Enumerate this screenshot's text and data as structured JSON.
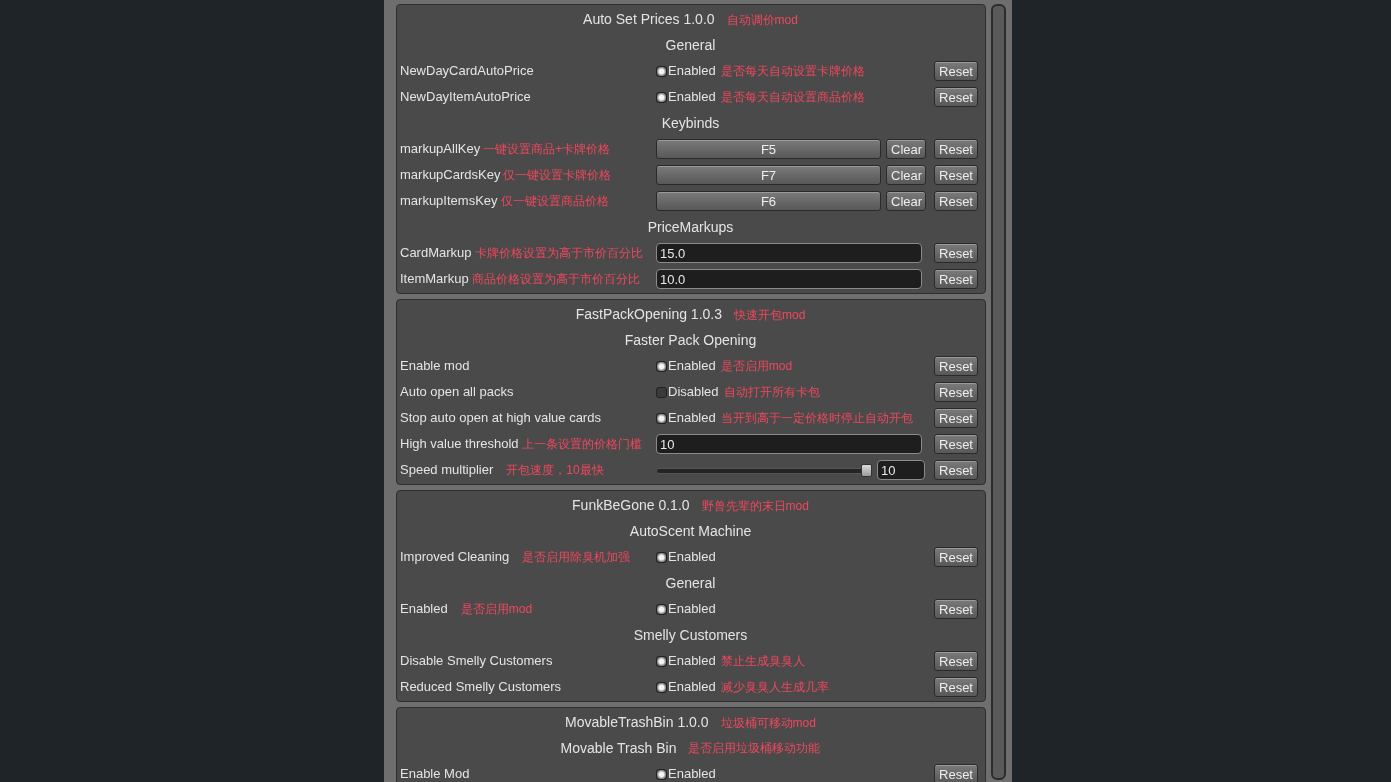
{
  "sections": [
    {
      "title": "Auto Set Prices 1.0.0",
      "note": "自动调价mod",
      "groups": [
        {
          "heading": "General",
          "rows": [
            {
              "kind": "toggle",
              "label": "NewDayCardAutoPrice",
              "checked": true,
              "state_text": "Enabled",
              "control_note": "是否每天自动设置卡牌价格",
              "reset": "Reset"
            },
            {
              "kind": "toggle",
              "label": "NewDayItemAutoPrice",
              "checked": true,
              "state_text": "Enabled",
              "control_note": "是否每天自动设置商品价格",
              "reset": "Reset"
            }
          ]
        },
        {
          "heading": "Keybinds",
          "rows": [
            {
              "kind": "key",
              "label": "markupAllKey",
              "value": "F5",
              "clear": "Clear",
              "label_note": "一键设置商品+卡牌价格",
              "reset": "Reset"
            },
            {
              "kind": "key",
              "label": "markupCardsKey",
              "value": "F7",
              "clear": "Clear",
              "label_note": "仅一键设置卡牌价格",
              "reset": "Reset"
            },
            {
              "kind": "key",
              "label": "markupItemsKey",
              "value": "F6",
              "clear": "Clear",
              "label_note": "仅一键设置商品价格",
              "reset": "Reset"
            }
          ]
        },
        {
          "heading": "PriceMarkups",
          "rows": [
            {
              "kind": "text",
              "label": "CardMarkup",
              "value": "15.0",
              "label_note": "卡牌价格设置为高于市价百分比",
              "reset": "Reset"
            },
            {
              "kind": "text",
              "label": "ItemMarkup",
              "value": "10.0",
              "label_note": "商品价格设置为高于市价百分比",
              "reset": "Reset"
            }
          ]
        }
      ]
    },
    {
      "title": "FastPackOpening 1.0.3",
      "note": "快速开包mod",
      "groups": [
        {
          "heading": "Faster Pack Opening",
          "rows": [
            {
              "kind": "toggle",
              "label": "Enable mod",
              "checked": true,
              "state_text": "Enabled",
              "control_note": "是否启用mod",
              "reset": "Reset"
            },
            {
              "kind": "toggle",
              "label": "Auto open all packs",
              "checked": false,
              "state_text": "Disabled",
              "control_note": "自动打开所有卡包",
              "reset": "Reset"
            },
            {
              "kind": "toggle",
              "label": "Stop auto open at high value cards",
              "checked": true,
              "state_text": "Enabled",
              "control_note": "当开到高于一定价格时停止自动开包",
              "reset": "Reset"
            },
            {
              "kind": "text",
              "label": "High value threshold",
              "value": "10",
              "label_note": "上一条设置的价格门槛",
              "reset": "Reset"
            },
            {
              "kind": "slider",
              "label": "Speed multiplier",
              "level": 1,
              "value": "10",
              "label_note": "开包速度，10最快",
              "reset": "Reset"
            }
          ]
        }
      ]
    },
    {
      "title": "FunkBeGone 0.1.0",
      "note": "野兽先辈的末日mod",
      "groups": [
        {
          "heading": "AutoScent Machine",
          "rows": [
            {
              "kind": "toggle",
              "label": "Improved Cleaning",
              "checked": true,
              "state_text": "Enabled",
              "label_note": "是否启用除臭机加强",
              "reset": "Reset"
            }
          ]
        },
        {
          "heading": "General",
          "rows": [
            {
              "kind": "toggle",
              "label": "Enabled",
              "checked": true,
              "state_text": "Enabled",
              "label_note": "是否启用mod",
              "reset": "Reset"
            }
          ]
        },
        {
          "heading": "Smelly Customers",
          "rows": [
            {
              "kind": "toggle",
              "label": "Disable Smelly Customers",
              "checked": true,
              "state_text": "Enabled",
              "control_note": "禁止生成臭臭人",
              "reset": "Reset"
            },
            {
              "kind": "toggle",
              "label": "Reduced Smelly Customers",
              "checked": true,
              "state_text": "Enabled",
              "control_note": "减少臭臭人生成几率",
              "reset": "Reset"
            }
          ]
        }
      ]
    },
    {
      "title": "MovableTrashBin 1.0.0",
      "note": "垃圾桶可移动mod",
      "groups": [
        {
          "heading": "Movable Trash Bin",
          "note": "是否启用垃圾桶移动功能",
          "rows": [
            {
              "kind": "toggle",
              "label": "Enable Mod",
              "checked": true,
              "state_text": "Enabled",
              "reset": "Reset"
            }
          ]
        }
      ]
    }
  ]
}
